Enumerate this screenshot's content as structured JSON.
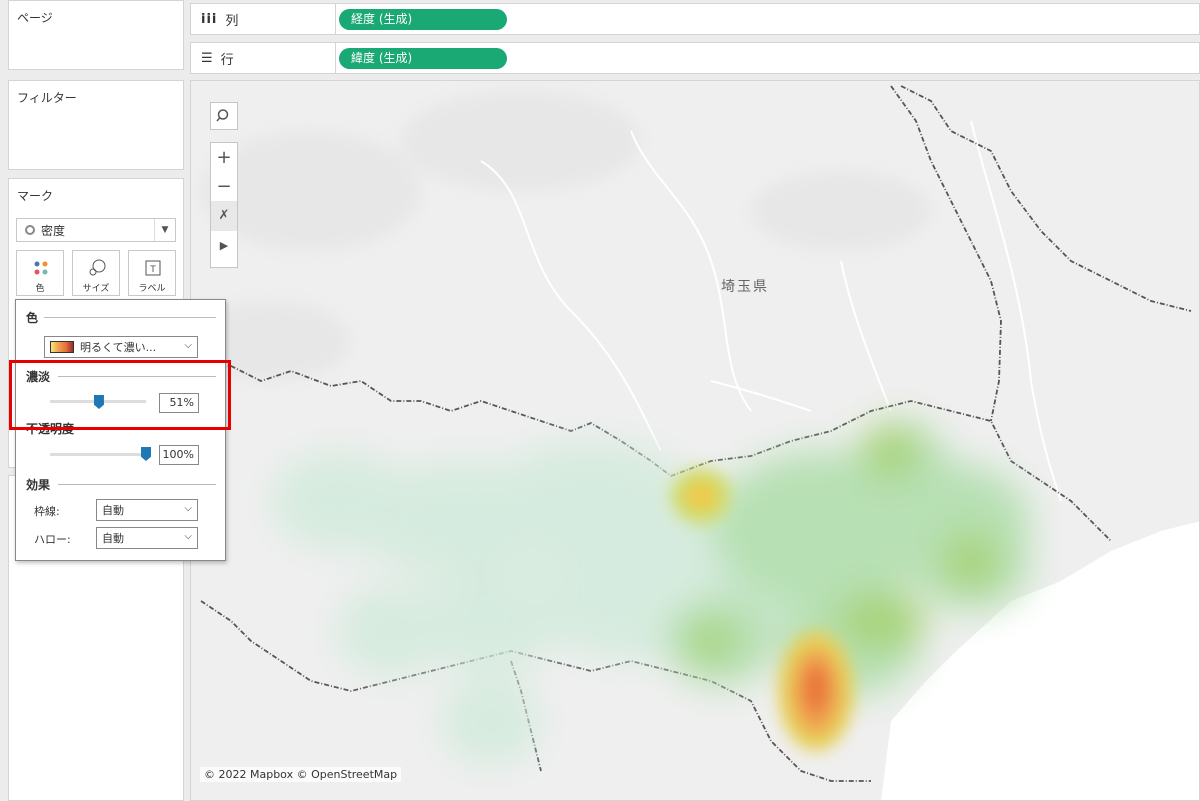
{
  "pages_panel": {
    "title": "ページ"
  },
  "filters_panel": {
    "title": "フィルター"
  },
  "marks_panel": {
    "title": "マーク",
    "mark_type": "密度",
    "buttons": [
      {
        "label": "色",
        "icon": "color-dots-icon"
      },
      {
        "label": "サイズ",
        "icon": "size-circles-icon"
      },
      {
        "label": "ラベル",
        "icon": "label-text-icon"
      }
    ]
  },
  "color_popup": {
    "color_section": "色",
    "palette_value": "明るくて濃い...",
    "intensity_section": "濃淡",
    "intensity_value": "51%",
    "intensity_fraction": 0.51,
    "opacity_section": "不透明度",
    "opacity_value": "100%",
    "opacity_fraction": 1.0,
    "effects_section": "効果",
    "border_label": "枠線:",
    "border_value": "自動",
    "halo_label": "ハロー:",
    "halo_value": "自動"
  },
  "shelves": {
    "columns": {
      "label": "列",
      "icon": "columns-icon",
      "pill": "経度 (生成)"
    },
    "rows": {
      "label": "行",
      "icon": "rows-icon",
      "pill": "緯度 (生成)"
    }
  },
  "map": {
    "place_label": "埼玉県",
    "attribution": "© 2022 Mapbox © OpenStreetMap",
    "controls": [
      "search-icon",
      "zoom-in-icon",
      "zoom-out-icon",
      "pin-reset-icon",
      "expand-arrow-icon"
    ]
  },
  "colors": {
    "pill": "#1aa874",
    "highlight": "#e60000",
    "slider_thumb": "#1f77b4",
    "density_low": "#cfe9d6",
    "density_mid": "#9ccf6a",
    "density_high": "#f0c94a",
    "density_peak": "#e8743a"
  }
}
